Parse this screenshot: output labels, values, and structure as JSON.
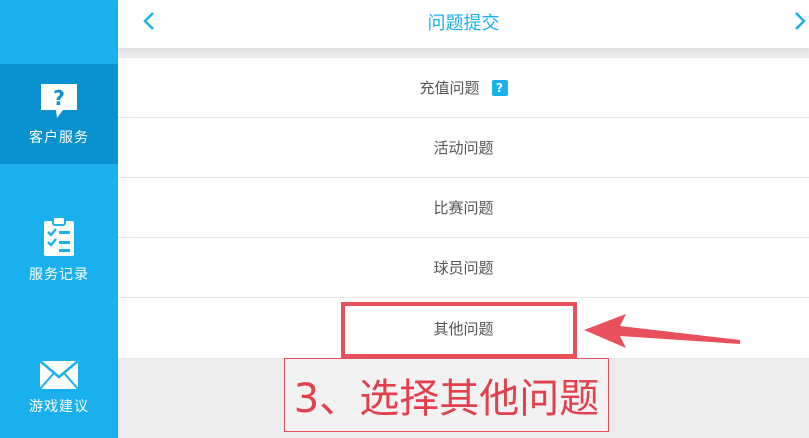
{
  "sidebar": {
    "items": [
      {
        "label": "客户服务",
        "icon": "help-bubble-icon",
        "active": true
      },
      {
        "label": "服务记录",
        "icon": "clipboard-checklist-icon",
        "active": false
      },
      {
        "label": "游戏建议",
        "icon": "envelope-icon",
        "active": false
      }
    ]
  },
  "header": {
    "title": "问题提交",
    "back_icon": "chevron-left-icon",
    "forward_icon": "chevron-right-icon"
  },
  "list": {
    "items": [
      {
        "label": "充值问题",
        "badge": "?"
      },
      {
        "label": "活动问题"
      },
      {
        "label": "比赛问题"
      },
      {
        "label": "球员问题"
      },
      {
        "label": "其他问题"
      }
    ]
  },
  "annotation": {
    "note": "3、选择其他问题",
    "color": "#e8505b"
  },
  "colors": {
    "accent": "#1ab0ee",
    "sidebar_active": "#0a92d0",
    "background": "#ececec"
  }
}
